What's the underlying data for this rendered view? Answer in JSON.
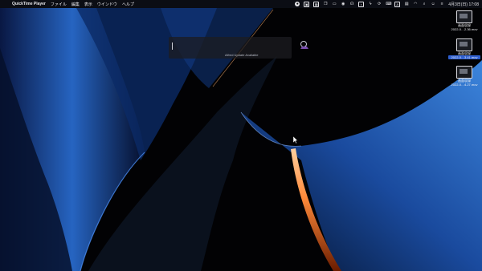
{
  "menubar": {
    "apple_glyph": "",
    "app_name": "QuickTime Player",
    "menus": [
      "ファイル",
      "編集",
      "表示",
      "ウインドウ",
      "ヘルプ"
    ],
    "status": {
      "icons": [
        "record-icon",
        "screenshot-icon",
        "calendar-icon",
        "clipboard-icon",
        "drive-icon",
        "media-icon",
        "headset-icon",
        "box-icon",
        "bolt-icon",
        "sync-icon",
        "keyboard-icon",
        "input-source-icon",
        "display-icon",
        "wifi-icon",
        "search-icon",
        "user-icon",
        "control-center-icon"
      ],
      "input_source_glyph": "A",
      "datetime": "4月3日(日) 17:08"
    }
  },
  "notification": {
    "text": "Alfred Update Available"
  },
  "desktop": {
    "files": [
      {
        "name": "画面収録",
        "sub": "2022-0…2.36.mov"
      },
      {
        "name": "画面収録",
        "sub": "2022-0…3.41.mov"
      },
      {
        "name": "画面収録",
        "sub": "2022-0…4.27.mov"
      }
    ]
  },
  "colors": {
    "wallpaper_blue": "#2a6fd6",
    "wallpaper_orange": "#ff8a3a",
    "menubar_bg": "#0c0e16"
  }
}
